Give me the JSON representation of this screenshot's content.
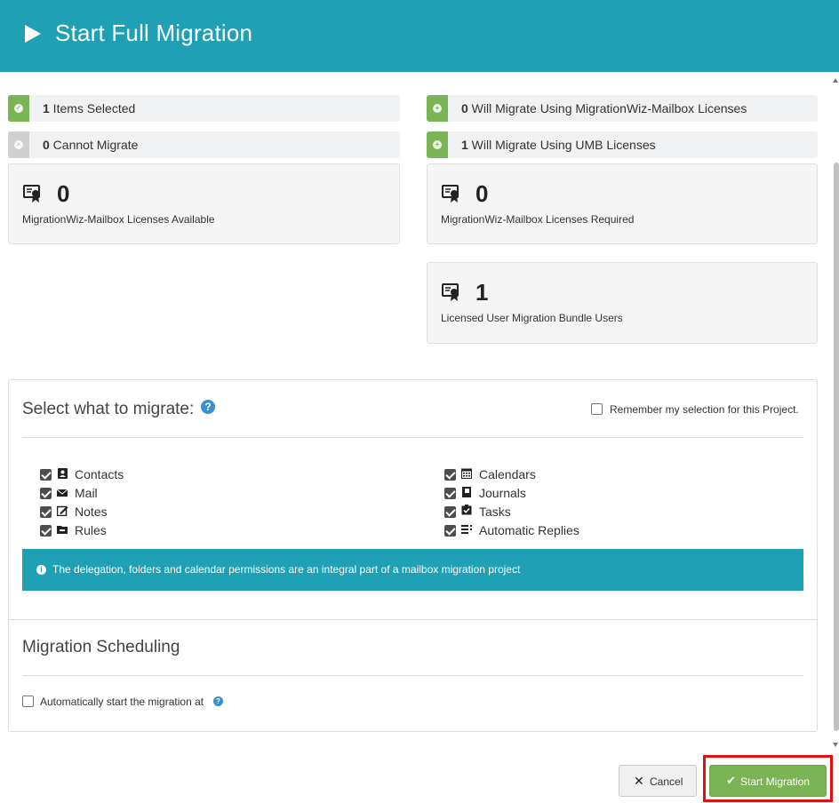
{
  "header": {
    "title": "Start Full Migration",
    "icon": "play-icon"
  },
  "status": {
    "items_selected": {
      "count": "1",
      "label": " Items Selected"
    },
    "cannot_migrate": {
      "count": "0",
      "label": " Cannot Migrate"
    },
    "migrate_mwz": {
      "count": "0",
      "label": " Will Migrate Using MigrationWiz-Mailbox Licenses"
    },
    "migrate_umb": {
      "count": "1",
      "label": " Will Migrate Using UMB Licenses"
    }
  },
  "cards": {
    "available": {
      "value": "0",
      "label": "MigrationWiz-Mailbox Licenses Available"
    },
    "required": {
      "value": "0",
      "label": "MigrationWiz-Mailbox Licenses Required"
    },
    "umb_users": {
      "value": "1",
      "label": "Licensed User Migration Bundle Users"
    }
  },
  "select": {
    "title": "Select what to migrate:",
    "remember_label": "Remember my selection for this Project.",
    "remember_checked": false,
    "options": [
      {
        "label": "Contacts",
        "icon": "contacts-icon",
        "checked": true
      },
      {
        "label": "Mail",
        "icon": "mail-icon",
        "checked": true
      },
      {
        "label": "Notes",
        "icon": "notes-icon",
        "checked": true
      },
      {
        "label": "Rules",
        "icon": "rules-icon",
        "checked": true
      },
      {
        "label": "Calendars",
        "icon": "calendar-icon",
        "checked": true
      },
      {
        "label": "Journals",
        "icon": "journal-icon",
        "checked": true
      },
      {
        "label": "Tasks",
        "icon": "tasks-icon",
        "checked": true
      },
      {
        "label": "Automatic Replies",
        "icon": "auto-reply-icon",
        "checked": true
      }
    ],
    "info": "The delegation, folders and calendar permissions are an integral part of a mailbox migration project"
  },
  "scheduling": {
    "title": "Migration Scheduling",
    "auto_start_label": "Automatically start the migration at",
    "auto_start_checked": false
  },
  "buttons": {
    "cancel": "Cancel",
    "start": "Start Migration"
  },
  "colors": {
    "header": "#1fa0b5",
    "accent_green": "#7ab454",
    "help_blue": "#3b8fd0",
    "highlight_red": "#e01010"
  }
}
